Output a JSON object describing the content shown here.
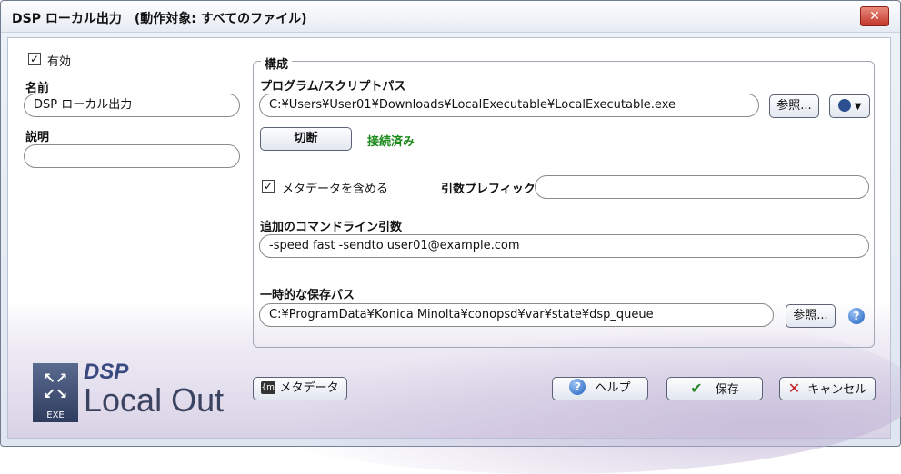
{
  "window": {
    "title": "DSP ローカル出力　(動作対象: すべてのファイル)",
    "close_glyph": "✕"
  },
  "left": {
    "enabled_label": "有効",
    "enabled_checked": true,
    "name_label": "名前",
    "name_value": "DSP ローカル出力",
    "description_label": "説明",
    "description_value": ""
  },
  "config": {
    "legend": "構成",
    "program_label": "プログラム/スクリプトパス",
    "program_path": "C:¥Users¥User01¥Downloads¥LocalExecutable¥LocalExecutable.exe",
    "browse_label": "参照...",
    "disconnect_label": "切断",
    "status": "接続済み",
    "include_metadata_label": "メタデータを含める",
    "include_metadata_checked": true,
    "arg_prefix_label": "引数プレフィックス",
    "arg_prefix_value": "",
    "extra_args_label": "追加のコマンドライン引数",
    "extra_args_value": "-speed fast -sendto  user01@example.com",
    "temp_path_label": "一時的な保存パス",
    "temp_path_value": "C:¥ProgramData¥Konica Minolta¥conopsd¥var¥state¥dsp_queue",
    "temp_browse_label": "参照..."
  },
  "footer": {
    "logo_line1": "DSP",
    "logo_line2": "Local Out",
    "logo_badge": "EXE",
    "metadata_button": "メタデータ",
    "help_button": "ヘルプ",
    "save_button": "保存",
    "cancel_button": "キャンセル"
  }
}
